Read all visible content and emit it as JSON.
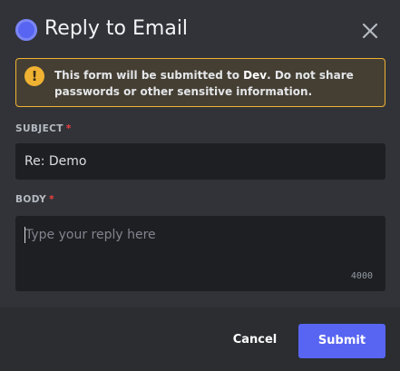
{
  "modal": {
    "title": "Reply to Email",
    "app_icon": "app-avatar-icon",
    "close_icon": "close-icon"
  },
  "warning": {
    "icon": "exclamation-icon",
    "text_prefix": "This form will be submitted to ",
    "app_name": "Dev",
    "text_suffix": ". Do not share passwords or other sensitive information.",
    "border_color": "#f0b232",
    "background_color": "#453f33"
  },
  "fields": {
    "subject": {
      "label": "SUBJECT",
      "required_mark": "*",
      "value": "Re: Demo"
    },
    "body": {
      "label": "BODY",
      "required_mark": "*",
      "placeholder": "Type your reply here",
      "value": "",
      "remaining_chars": "4000"
    }
  },
  "footer": {
    "cancel_label": "Cancel",
    "submit_label": "Submit",
    "submit_color": "#5865f2"
  },
  "colors": {
    "modal_bg": "#313338",
    "footer_bg": "#2b2d31",
    "input_bg": "#1e1f22",
    "required": "#f23f43"
  }
}
